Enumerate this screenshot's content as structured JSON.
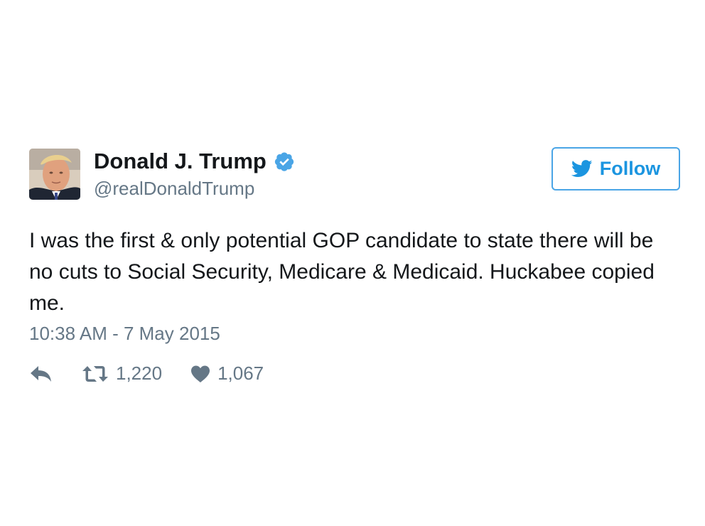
{
  "user": {
    "display_name": "Donald J. Trump",
    "handle": "@realDonaldTrump",
    "verified": true,
    "avatar": "profile-photo"
  },
  "follow_button": {
    "label": "Follow",
    "icon": "twitter-bird-icon"
  },
  "tweet": {
    "text": "I was the first & only potential GOP candidate to state there will be no cuts to Social Security, Medicare & Medicaid. Huckabee copied me.",
    "timestamp": "10:38 AM - 7 May 2015"
  },
  "actions": {
    "reply_icon": "reply-icon",
    "retweet_icon": "retweet-icon",
    "retweet_count": "1,220",
    "like_icon": "heart-icon",
    "like_count": "1,067"
  },
  "colors": {
    "accent": "#1b95e0",
    "verified": "#4aa5e6",
    "secondary_text": "#657786",
    "primary_text": "#14171a"
  }
}
